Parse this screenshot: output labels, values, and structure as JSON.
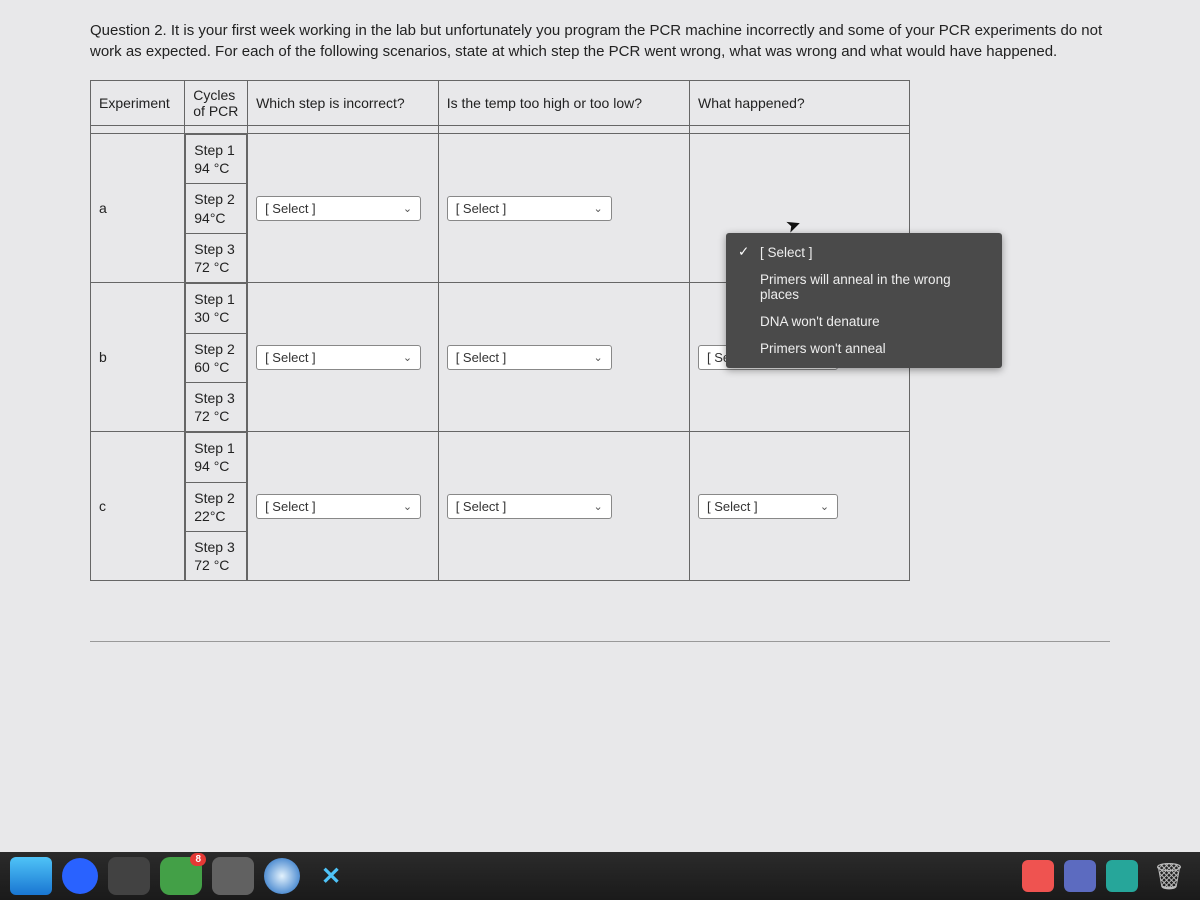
{
  "question": {
    "prefix": "Question 2.",
    "text": "It is your first week working in the lab but unfortunately you program the PCR machine incorrectly and some of your PCR experiments do not work as expected.  For each of the following scenarios, state at which step the PCR went wrong, what was wrong and what would have happened."
  },
  "headers": {
    "experiment": "Experiment",
    "cycles": "Cycles of PCR",
    "which_step": "Which step is incorrect?",
    "temp": "Is the temp too high or too low?",
    "what": "What happened?"
  },
  "rows": [
    {
      "id": "a",
      "steps": [
        {
          "label": "Step 1",
          "temp": "94 °C"
        },
        {
          "label": "Step 2",
          "temp": "94°C"
        },
        {
          "label": "Step 3",
          "temp": "72 °C"
        }
      ]
    },
    {
      "id": "b",
      "steps": [
        {
          "label": "Step 1",
          "temp": "30 °C"
        },
        {
          "label": "Step 2",
          "temp": "60 °C"
        },
        {
          "label": "Step 3",
          "temp": "72 °C"
        }
      ]
    },
    {
      "id": "c",
      "steps": [
        {
          "label": "Step 1",
          "temp": "94 °C"
        },
        {
          "label": "Step 2",
          "temp": "22°C"
        },
        {
          "label": "Step 3",
          "temp": "72 °C"
        }
      ]
    }
  ],
  "select_placeholder": "[ Select ]",
  "dropdown": {
    "options": [
      "[ Select ]",
      "Primers will anneal in the wrong places",
      "DNA won't denature",
      "Primers won't anneal"
    ],
    "selected_index": 0
  },
  "taskbar": {
    "badge": "8"
  }
}
